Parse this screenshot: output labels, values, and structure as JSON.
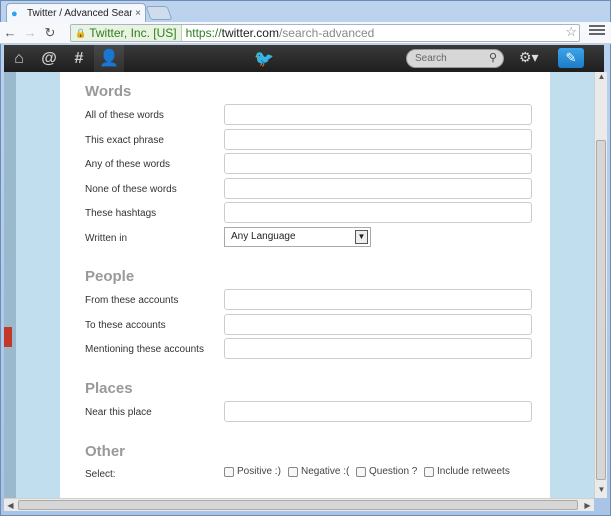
{
  "browser": {
    "tab_title": "Twitter / Advanced Search",
    "tab_close": "×",
    "back": "←",
    "forward": "→",
    "reload": "↻",
    "ev_label": "Twitter, Inc. [US]",
    "url_scheme": "https://",
    "url_host": "twitter.com",
    "url_path": "/search-advanced",
    "star": "☆"
  },
  "twitter_nav": {
    "home": "⌂",
    "connect": "@",
    "discover": "#",
    "me": "👤",
    "bird": "🐦",
    "search_placeholder": "Search",
    "search_icon": "⚲",
    "gear": "⚙▾",
    "compose": "✎"
  },
  "form": {
    "sections": {
      "words": "Words",
      "people": "People",
      "places": "Places",
      "other": "Other"
    },
    "words": {
      "all": "All of these words",
      "exact": "This exact phrase",
      "any": "Any of these words",
      "none": "None of these words",
      "hashtags": "These hashtags",
      "written_in": "Written in",
      "language_value": "Any Language"
    },
    "people": {
      "from": "From these accounts",
      "to": "To these accounts",
      "mentioning": "Mentioning these accounts"
    },
    "places": {
      "near": "Near this place"
    },
    "other": {
      "select": "Select:",
      "positive": "Positive :)",
      "negative": "Negative :(",
      "question": "Question ?",
      "retweets": "Include retweets"
    }
  }
}
